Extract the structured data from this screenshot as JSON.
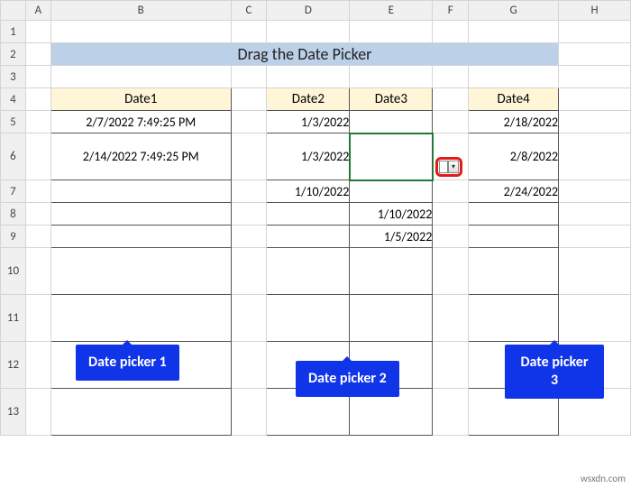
{
  "columns": [
    "A",
    "B",
    "C",
    "D",
    "E",
    "F",
    "G",
    "H"
  ],
  "row_numbers": [
    "1",
    "2",
    "3",
    "4",
    "5",
    "6",
    "7",
    "8",
    "9",
    "10",
    "11",
    "12",
    "13"
  ],
  "title": "Drag the Date Picker",
  "headers": {
    "date1": "Date1",
    "date2": "Date2",
    "date3": "Date3",
    "date4": "Date4"
  },
  "date1": {
    "r5": "2/7/2022  7:49:25 PM",
    "r6": "2/14/2022  7:49:25 PM"
  },
  "date2": {
    "r5": "1/3/2022",
    "r6": "1/3/2022",
    "r7": "1/10/2022"
  },
  "date3": {
    "r8": "1/10/2022",
    "r9": "1/5/2022"
  },
  "date4": {
    "r5": "2/18/2022",
    "r6": "2/8/2022",
    "r7": "2/24/2022"
  },
  "callouts": {
    "c1": "Date picker 1",
    "c2": "Date picker 2",
    "c3": "Date picker 3"
  },
  "picker_arrow": "▾",
  "watermark": "wsxdn.com"
}
